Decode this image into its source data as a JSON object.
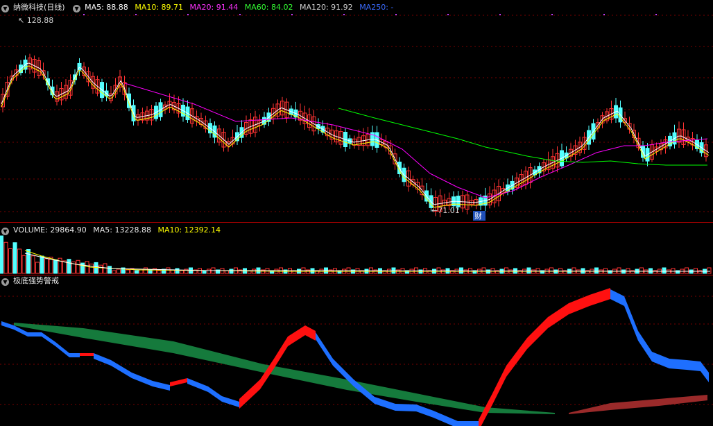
{
  "price_header": {
    "title": "纳微科技(日线)",
    "ma5": "MA5: 88.88",
    "ma10": "MA10: 89.71",
    "ma20": "MA20: 91.44",
    "ma60": "MA60: 84.02",
    "ma120": "MA120: 91.92",
    "ma250": "MA250: -",
    "high_marker": "128.88",
    "low_marker": "71.01",
    "event_badge": "财"
  },
  "volume_header": {
    "volume": "VOLUME: 29864.90",
    "ma5": "MA5: 13228.88",
    "ma10": "MA10: 12392.14"
  },
  "indicator_header": {
    "name": "极底强势警戒"
  },
  "colors": {
    "background": "#000000",
    "up_candle": "#ff3333",
    "down_candle": "#54ffff",
    "ma5": "#ffffff",
    "ma10": "#ffff00",
    "ma20": "#ff00ff",
    "ma60": "#00ff00",
    "ma120": "#c0c0c0",
    "ma250": "#2b6cff",
    "grid": "#7a0000",
    "indicator_red": "#ff1010",
    "indicator_blue": "#1e6fff",
    "indicator_green": "#157a3c",
    "indicator_brown": "#9a2a2a"
  },
  "icons": {
    "collapse": "chevron-down-icon"
  }
}
